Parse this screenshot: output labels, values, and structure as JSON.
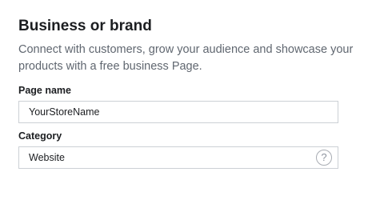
{
  "section": {
    "title": "Business or brand",
    "description": "Connect with customers, grow your audience and showcase your products with a free business Page."
  },
  "fields": {
    "page_name": {
      "label": "Page name",
      "value": "YourStoreName"
    },
    "category": {
      "label": "Category",
      "value": "Website",
      "help_icon": "question-circle-icon",
      "help_glyph": "?"
    }
  }
}
